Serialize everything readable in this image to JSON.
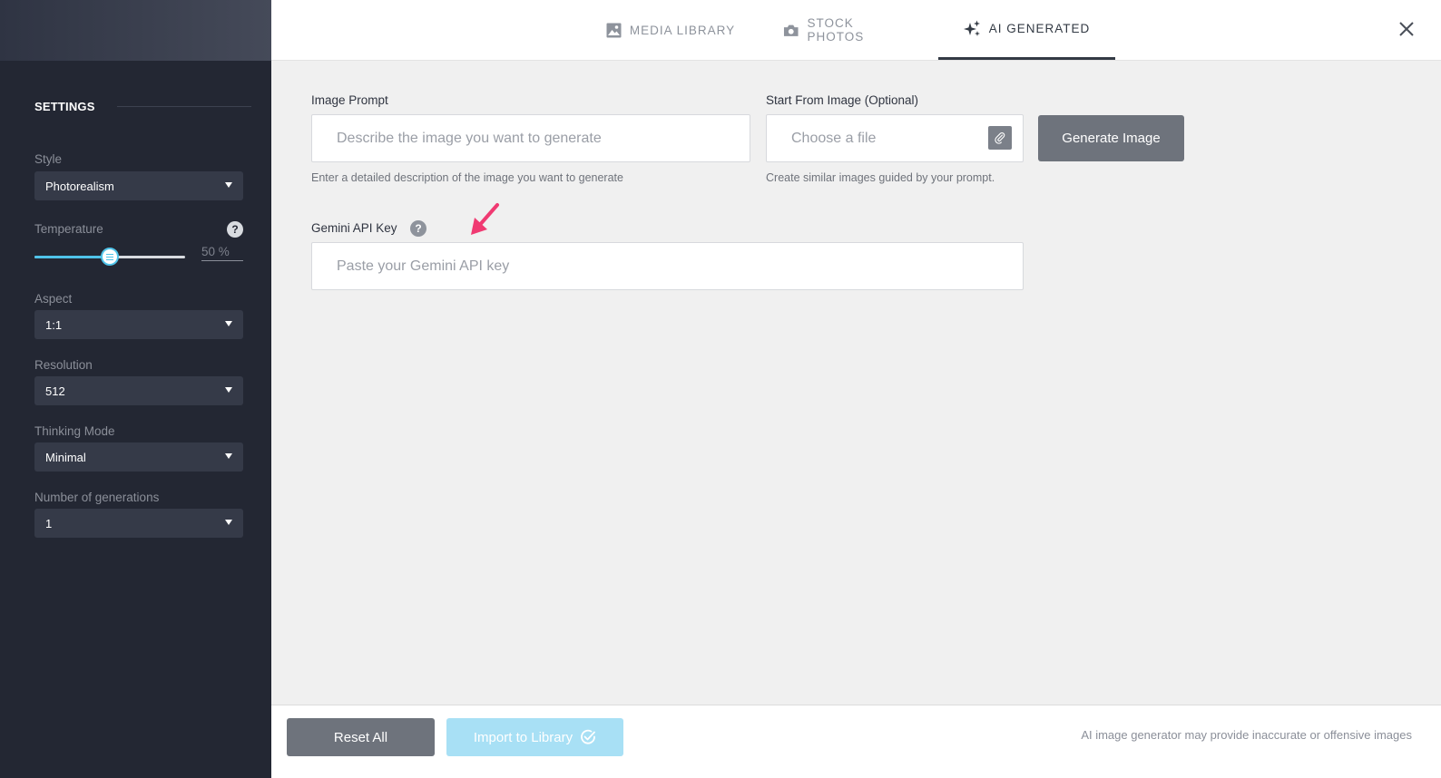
{
  "tabs": [
    {
      "label": "MEDIA LIBRARY",
      "icon": "image-icon"
    },
    {
      "label": "STOCK PHOTOS",
      "icon": "camera-icon"
    },
    {
      "label": "AI GENERATED",
      "icon": "sparkle-icon",
      "active": true
    }
  ],
  "sidebar": {
    "heading": "SETTINGS",
    "style": {
      "label": "Style",
      "value": "Photorealism"
    },
    "temperature": {
      "label": "Temperature",
      "value_text": "50 %",
      "value": 0.5
    },
    "aspect": {
      "label": "Aspect",
      "value": "1:1"
    },
    "resolution": {
      "label": "Resolution",
      "value": "512"
    },
    "thinking_mode": {
      "label": "Thinking Mode",
      "value": "Minimal"
    },
    "generations": {
      "label": "Number of generations",
      "value": "1"
    }
  },
  "form": {
    "prompt_label": "Image Prompt",
    "prompt_placeholder": "Describe the image you want to generate",
    "prompt_hint": "Enter a detailed description of the image you want to generate",
    "start_image_label": "Start From Image (Optional)",
    "start_image_placeholder": "Choose a file",
    "start_image_hint": "Create similar images guided by your prompt.",
    "generate_label": "Generate Image",
    "api_key_label": "Gemini API Key",
    "api_key_placeholder": "Paste your Gemini API key"
  },
  "footer": {
    "reset_label": "Reset All",
    "import_label": "Import to Library",
    "disclaimer": "AI image generator may provide inaccurate or offensive images"
  },
  "colors": {
    "sidebar_bg": "#232733",
    "accent": "#4fc3e9",
    "annotation_arrow": "#f03a72"
  }
}
